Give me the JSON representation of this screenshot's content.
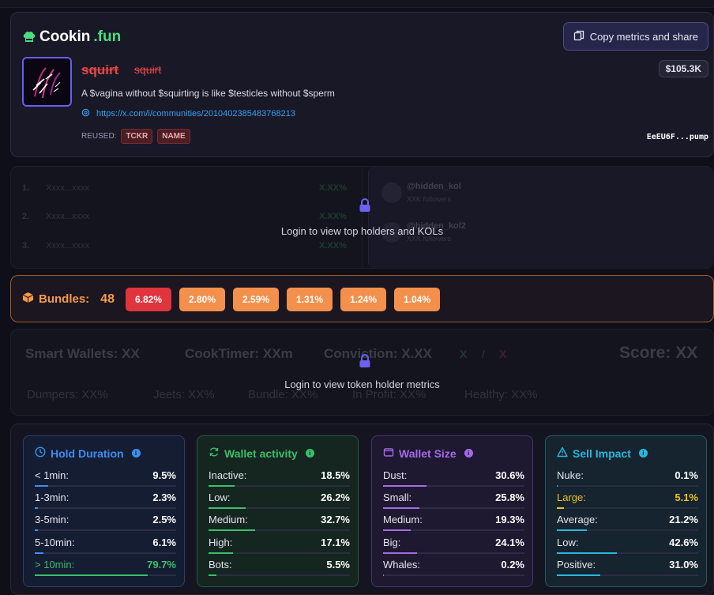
{
  "header": {
    "logo_main": "Cookin",
    "logo_accent": ".fun",
    "copy_button": "Copy metrics and share",
    "token_name": "squirt",
    "token_ticker": "squirt",
    "market_cap": "$105.3K",
    "description": "A $vagina without $squirting is like $testicles without $sperm",
    "link": "https://x.com/i/communities/2010402385483768213",
    "reused_label": "REUSED:",
    "tags": [
      "TCKR",
      "NAME"
    ],
    "address": "EeEU6F...pump"
  },
  "holders_locked": {
    "message": "Login to view top holders and KOLs",
    "rows": [
      {
        "rank": "1.",
        "addr": "Xxxx...xxxx",
        "pct": "X.XX%"
      },
      {
        "rank": "2.",
        "addr": "Xxxx...xxxx",
        "pct": "X.XX%"
      },
      {
        "rank": "3.",
        "addr": "Xxxx...xxxx",
        "pct": "X.XX%"
      }
    ],
    "kol_name": "@hidden_kol",
    "kol_followers": "XXK followers",
    "kol2_name": "@hidden_kol2",
    "kol2_followers": "XXK followers"
  },
  "bundles": {
    "label": "Bundles:",
    "count": "48",
    "values": [
      "6.82%",
      "2.80%",
      "2.59%",
      "1.31%",
      "1.24%",
      "1.04%"
    ]
  },
  "metrics_locked": {
    "message": "Login to view token holder metrics",
    "smart_wallets": "Smart Wallets: XX",
    "cook_timer": "CookTimer: XXm",
    "conviction": "Conviction: X.XX",
    "trend_up": "X",
    "trend_sep": "/",
    "trend_down": "X",
    "score": "Score: XX",
    "dumpers": "Dumpers: XX%",
    "jeets": "Jeets: XX%",
    "bundle": "Bundle: XX%",
    "in_profit": "In Profit: XX%",
    "healthy": "Healthy: XX%"
  },
  "stats": [
    {
      "title": "Hold Duration",
      "color": "#3b8ff0",
      "rows": [
        {
          "label": "< 1min:",
          "value": "9.5%",
          "fraction": 0.095
        },
        {
          "label": "1-3min:",
          "value": "2.3%",
          "fraction": 0.023
        },
        {
          "label": "3-5min:",
          "value": "2.5%",
          "fraction": 0.025
        },
        {
          "label": "5-10min:",
          "value": "6.1%",
          "fraction": 0.061
        },
        {
          "label": "> 10min:",
          "value": "79.7%",
          "fraction": 0.797,
          "highlight": "#3bbf6b"
        }
      ]
    },
    {
      "title": "Wallet activity",
      "color": "#3bbf6b",
      "rows": [
        {
          "label": "Inactive:",
          "value": "18.5%",
          "fraction": 0.185
        },
        {
          "label": "Low:",
          "value": "26.2%",
          "fraction": 0.262
        },
        {
          "label": "Medium:",
          "value": "32.7%",
          "fraction": 0.327
        },
        {
          "label": "High:",
          "value": "17.1%",
          "fraction": 0.171
        },
        {
          "label": "Bots:",
          "value": "5.5%",
          "fraction": 0.055
        }
      ]
    },
    {
      "title": "Wallet Size",
      "color": "#a46be8",
      "rows": [
        {
          "label": "Dust:",
          "value": "30.6%",
          "fraction": 0.306
        },
        {
          "label": "Small:",
          "value": "25.8%",
          "fraction": 0.258
        },
        {
          "label": "Medium:",
          "value": "19.3%",
          "fraction": 0.193
        },
        {
          "label": "Big:",
          "value": "24.1%",
          "fraction": 0.241
        },
        {
          "label": "Whales:",
          "value": "0.2%",
          "fraction": 0.002
        }
      ]
    },
    {
      "title": "Sell Impact",
      "color": "#2ab7de",
      "rows": [
        {
          "label": "Nuke:",
          "value": "0.1%",
          "fraction": 0.001
        },
        {
          "label": "Large:",
          "value": "5.1%",
          "fraction": 0.051,
          "highlight": "#f0c020"
        },
        {
          "label": "Average:",
          "value": "21.2%",
          "fraction": 0.212
        },
        {
          "label": "Low:",
          "value": "42.6%",
          "fraction": 0.426
        },
        {
          "label": "Positive:",
          "value": "31.0%",
          "fraction": 0.31
        }
      ]
    }
  ]
}
